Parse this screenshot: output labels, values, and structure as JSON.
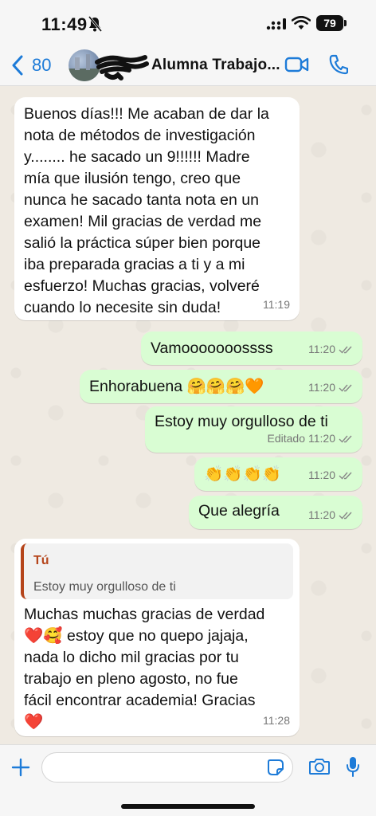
{
  "status_bar": {
    "time": "11:49",
    "battery": "79"
  },
  "header": {
    "back_count": "80",
    "contact_name": "Alumna Trabajo..."
  },
  "messages": [
    {
      "direction": "incoming",
      "text": "Buenos días!!! Me acaban de dar la\nnota de métodos de investigación\ny........ he sacado un 9!!!!!! Madre\nmía que ilusión tengo, creo que\nnunca he sacado tanta nota en un\nexamen! Mil gracias de verdad me\nsalió la práctica súper bien porque\niba preparada gracias a ti y a mi\nesfuerzo! Muchas gracias, volveré\ncuando lo necesite sin duda!",
      "time": "11:19"
    },
    {
      "direction": "outgoing",
      "text": "Vamooooooossss",
      "time": "11:20"
    },
    {
      "direction": "outgoing",
      "text": "Enhorabuena 🤗🤗🤗🧡",
      "time": "11:20"
    },
    {
      "direction": "outgoing",
      "text": "Estoy muy orgulloso de ti",
      "edited": "Editado",
      "time": "11:20"
    },
    {
      "direction": "outgoing",
      "text": "👏👏👏👏",
      "time": "11:20"
    },
    {
      "direction": "outgoing",
      "text": "Que alegría",
      "time": "11:20"
    },
    {
      "direction": "incoming",
      "reply_author": "Tú",
      "reply_text": "Estoy muy orgulloso de ti",
      "text": "Muchas muchas gracias de verdad\n❤️🥰 estoy que no quepo jajaja,\nnada lo dicho mil gracias por tu\ntrabajo en pleno agosto, no fue\nfácil encontrar academia! Gracias\n❤️",
      "time": "11:28"
    }
  ],
  "input": {
    "value": "",
    "placeholder": ""
  },
  "colors": {
    "accent": "#1d7bd8",
    "outgoing_bubble": "#d9fdd3",
    "incoming_bubble": "#ffffff",
    "chat_background": "#efeae2",
    "reply_accent": "#b5451b"
  }
}
